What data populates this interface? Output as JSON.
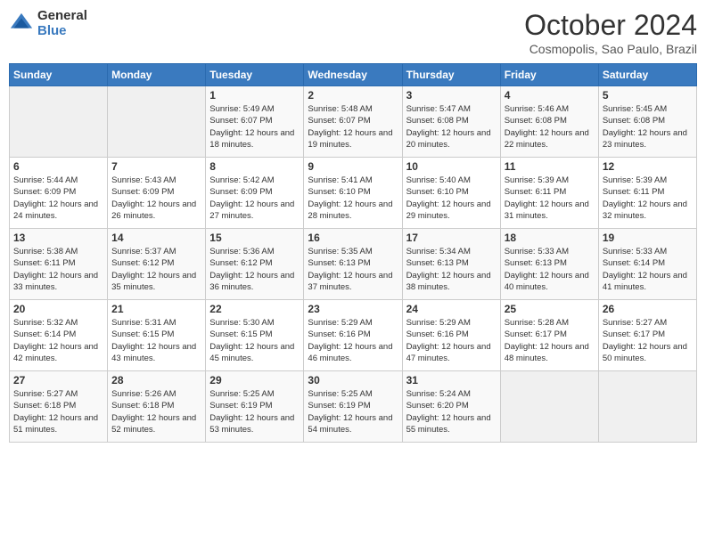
{
  "header": {
    "logo_general": "General",
    "logo_blue": "Blue",
    "month_title": "October 2024",
    "location": "Cosmopolis, Sao Paulo, Brazil"
  },
  "weekdays": [
    "Sunday",
    "Monday",
    "Tuesday",
    "Wednesday",
    "Thursday",
    "Friday",
    "Saturday"
  ],
  "weeks": [
    [
      {
        "day": "",
        "info": ""
      },
      {
        "day": "",
        "info": ""
      },
      {
        "day": "1",
        "info": "Sunrise: 5:49 AM\nSunset: 6:07 PM\nDaylight: 12 hours and 18 minutes."
      },
      {
        "day": "2",
        "info": "Sunrise: 5:48 AM\nSunset: 6:07 PM\nDaylight: 12 hours and 19 minutes."
      },
      {
        "day": "3",
        "info": "Sunrise: 5:47 AM\nSunset: 6:08 PM\nDaylight: 12 hours and 20 minutes."
      },
      {
        "day": "4",
        "info": "Sunrise: 5:46 AM\nSunset: 6:08 PM\nDaylight: 12 hours and 22 minutes."
      },
      {
        "day": "5",
        "info": "Sunrise: 5:45 AM\nSunset: 6:08 PM\nDaylight: 12 hours and 23 minutes."
      }
    ],
    [
      {
        "day": "6",
        "info": "Sunrise: 5:44 AM\nSunset: 6:09 PM\nDaylight: 12 hours and 24 minutes."
      },
      {
        "day": "7",
        "info": "Sunrise: 5:43 AM\nSunset: 6:09 PM\nDaylight: 12 hours and 26 minutes."
      },
      {
        "day": "8",
        "info": "Sunrise: 5:42 AM\nSunset: 6:09 PM\nDaylight: 12 hours and 27 minutes."
      },
      {
        "day": "9",
        "info": "Sunrise: 5:41 AM\nSunset: 6:10 PM\nDaylight: 12 hours and 28 minutes."
      },
      {
        "day": "10",
        "info": "Sunrise: 5:40 AM\nSunset: 6:10 PM\nDaylight: 12 hours and 29 minutes."
      },
      {
        "day": "11",
        "info": "Sunrise: 5:39 AM\nSunset: 6:11 PM\nDaylight: 12 hours and 31 minutes."
      },
      {
        "day": "12",
        "info": "Sunrise: 5:39 AM\nSunset: 6:11 PM\nDaylight: 12 hours and 32 minutes."
      }
    ],
    [
      {
        "day": "13",
        "info": "Sunrise: 5:38 AM\nSunset: 6:11 PM\nDaylight: 12 hours and 33 minutes."
      },
      {
        "day": "14",
        "info": "Sunrise: 5:37 AM\nSunset: 6:12 PM\nDaylight: 12 hours and 35 minutes."
      },
      {
        "day": "15",
        "info": "Sunrise: 5:36 AM\nSunset: 6:12 PM\nDaylight: 12 hours and 36 minutes."
      },
      {
        "day": "16",
        "info": "Sunrise: 5:35 AM\nSunset: 6:13 PM\nDaylight: 12 hours and 37 minutes."
      },
      {
        "day": "17",
        "info": "Sunrise: 5:34 AM\nSunset: 6:13 PM\nDaylight: 12 hours and 38 minutes."
      },
      {
        "day": "18",
        "info": "Sunrise: 5:33 AM\nSunset: 6:13 PM\nDaylight: 12 hours and 40 minutes."
      },
      {
        "day": "19",
        "info": "Sunrise: 5:33 AM\nSunset: 6:14 PM\nDaylight: 12 hours and 41 minutes."
      }
    ],
    [
      {
        "day": "20",
        "info": "Sunrise: 5:32 AM\nSunset: 6:14 PM\nDaylight: 12 hours and 42 minutes."
      },
      {
        "day": "21",
        "info": "Sunrise: 5:31 AM\nSunset: 6:15 PM\nDaylight: 12 hours and 43 minutes."
      },
      {
        "day": "22",
        "info": "Sunrise: 5:30 AM\nSunset: 6:15 PM\nDaylight: 12 hours and 45 minutes."
      },
      {
        "day": "23",
        "info": "Sunrise: 5:29 AM\nSunset: 6:16 PM\nDaylight: 12 hours and 46 minutes."
      },
      {
        "day": "24",
        "info": "Sunrise: 5:29 AM\nSunset: 6:16 PM\nDaylight: 12 hours and 47 minutes."
      },
      {
        "day": "25",
        "info": "Sunrise: 5:28 AM\nSunset: 6:17 PM\nDaylight: 12 hours and 48 minutes."
      },
      {
        "day": "26",
        "info": "Sunrise: 5:27 AM\nSunset: 6:17 PM\nDaylight: 12 hours and 50 minutes."
      }
    ],
    [
      {
        "day": "27",
        "info": "Sunrise: 5:27 AM\nSunset: 6:18 PM\nDaylight: 12 hours and 51 minutes."
      },
      {
        "day": "28",
        "info": "Sunrise: 5:26 AM\nSunset: 6:18 PM\nDaylight: 12 hours and 52 minutes."
      },
      {
        "day": "29",
        "info": "Sunrise: 5:25 AM\nSunset: 6:19 PM\nDaylight: 12 hours and 53 minutes."
      },
      {
        "day": "30",
        "info": "Sunrise: 5:25 AM\nSunset: 6:19 PM\nDaylight: 12 hours and 54 minutes."
      },
      {
        "day": "31",
        "info": "Sunrise: 5:24 AM\nSunset: 6:20 PM\nDaylight: 12 hours and 55 minutes."
      },
      {
        "day": "",
        "info": ""
      },
      {
        "day": "",
        "info": ""
      }
    ]
  ]
}
